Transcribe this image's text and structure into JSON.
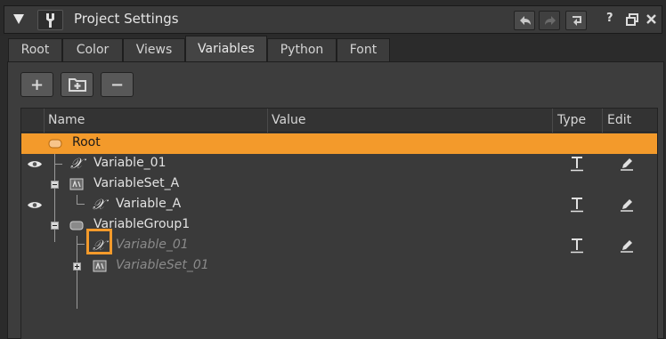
{
  "window": {
    "title": "Project Settings",
    "help_glyph": "?"
  },
  "tabs": [
    {
      "label": "Root"
    },
    {
      "label": "Color"
    },
    {
      "label": "Views"
    },
    {
      "label": "Variables",
      "active": true
    },
    {
      "label": "Python"
    },
    {
      "label": "Font"
    }
  ],
  "toolbar": {
    "add_glyph": "+",
    "remove_glyph": "−"
  },
  "table": {
    "columns": {
      "name": "Name",
      "value": "Value",
      "type": "Type",
      "edit": "Edit"
    },
    "rows": [
      {
        "label": "Root",
        "kind": "root",
        "selected": true
      },
      {
        "label": "Variable_01",
        "kind": "variable",
        "visible": true,
        "type_icon": "text-type-icon",
        "edit_icon": "pencil-icon"
      },
      {
        "label": "VariableSet_A",
        "kind": "variable-set",
        "expanded": true
      },
      {
        "label": "Variable_A",
        "kind": "variable",
        "visible": true,
        "type_icon": "text-type-icon",
        "edit_icon": "pencil-icon"
      },
      {
        "label": "VariableGroup1",
        "kind": "variable-group",
        "expanded": true
      },
      {
        "label": "Variable_01",
        "kind": "variable-reference",
        "disabled": true,
        "type_icon": "text-type-icon",
        "edit_icon": "pencil-icon"
      },
      {
        "label": "VariableSet_01",
        "kind": "variable-set",
        "disabled": true,
        "expanded": false
      }
    ]
  },
  "colors": {
    "selection": "#f39a2b",
    "panel": "#3d3d3d",
    "background": "#2b2b2b"
  }
}
